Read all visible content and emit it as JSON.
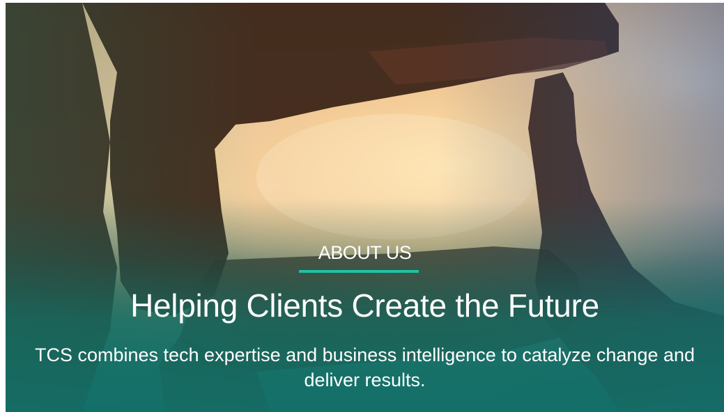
{
  "hero": {
    "eyebrow": "ABOUT US",
    "headline": "Helping Clients Create the Future",
    "subline": "TCS combines tech expertise and business intelligence to catalyze change and deliver results.",
    "image_subject": "hands-framing-sunset-photo"
  },
  "colors": {
    "accent_underline": "#1ec3a6",
    "text": "#ffffff",
    "overlay_teal": "#12706a",
    "overlay_blue": "#1e468c"
  }
}
